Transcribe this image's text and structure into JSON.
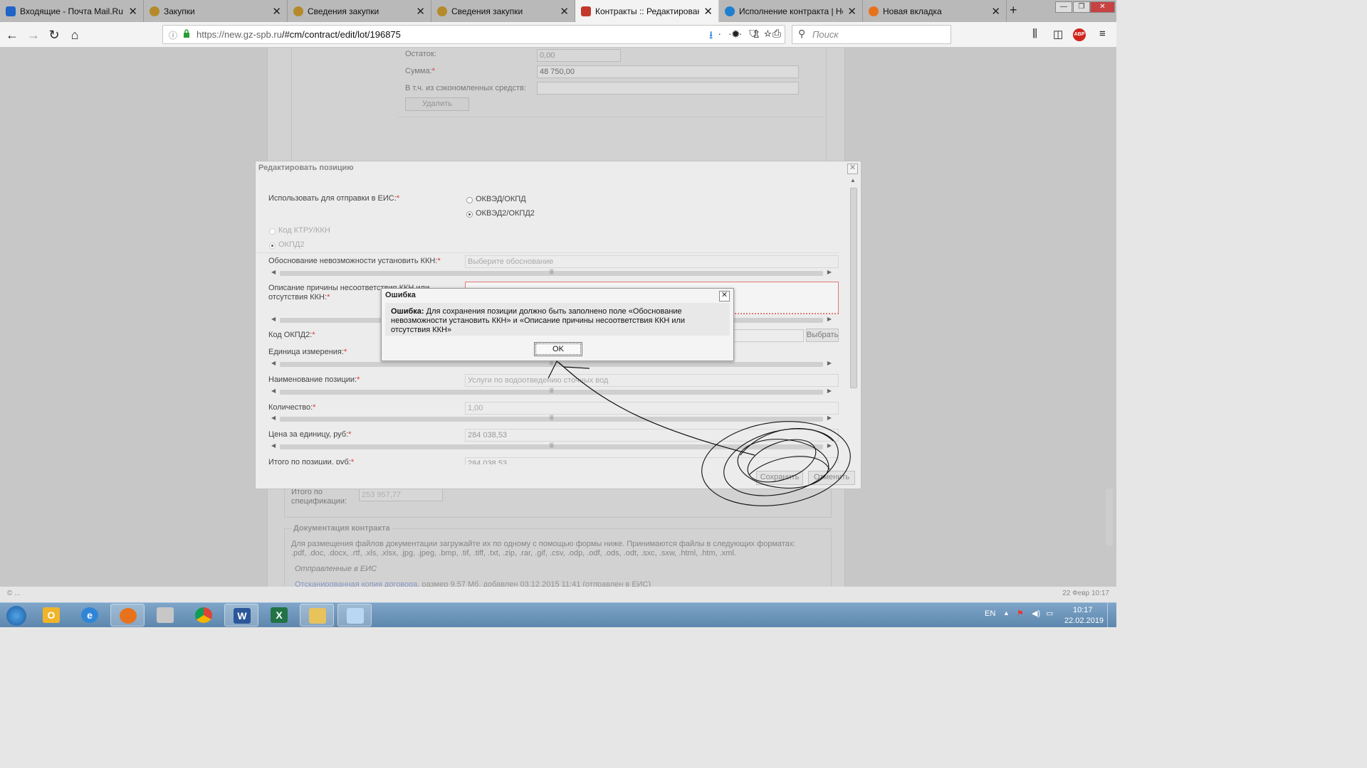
{
  "browser": {
    "tabs": [
      {
        "label": "Входящие - Почта Mail.Ru",
        "icon": "mail-icon",
        "color": "#1f64c6"
      },
      {
        "label": "Закупки",
        "icon": "emblem-icon",
        "color": "#b58a2a"
      },
      {
        "label": "Сведения закупки",
        "icon": "emblem-icon",
        "color": "#b58a2a"
      },
      {
        "label": "Сведения закупки",
        "icon": "emblem-icon",
        "color": "#b58a2a"
      },
      {
        "label": "Контракты :: Редактирование",
        "icon": "tools-icon",
        "color": "#c0392b"
      },
      {
        "label": "Исполнение контракта | Help",
        "icon": "help-icon",
        "color": "#1e7fd0"
      },
      {
        "label": "Новая вкладка",
        "icon": "firefox-icon",
        "color": "#e8721c"
      }
    ],
    "active_tab": 4,
    "url_host": "https://new.gz-spb.ru",
    "url_path": "/#cm/contract/edit/lot/196875",
    "search_placeholder": "Поиск",
    "adblock_badge": "ABP"
  },
  "background": {
    "ostatok_label": "Остаток:",
    "ostatok_value": "0,00",
    "summa_label": "Сумма:",
    "summa_value": "48 750,00",
    "saved_label": "В т.ч. из сэкономленных средств:",
    "delete_button": "Удалить",
    "spec_total_label": "Итого по спецификации:",
    "spec_total_value": "253 957,77",
    "docs_heading": "Документация контракта",
    "docs_hint": "Для размещения файлов документации загружайте их по одному с помощью формы ниже. Принимаются файлы в следующих форматах: .pdf, .doc, .docx, .rtf, .xls, .xlsx, .jpg, .jpeg, .bmp, .tif, .tiff, .txt, .zip, .rar, .gif, .csv, .odp, .odf, .ods, .odt, .sxc, .sxw, .html, .htm, .xml.",
    "sent_heading": "Отправленные в ЕИС",
    "file_link": "Отсканированная копия договора",
    "file_meta": ", размер 9,57 Мб, добавлен 03.12.2015 11:41 (отправлен в ЕИС)"
  },
  "edit_dialog": {
    "title": "Редактировать позицию",
    "send_label": "Использовать для отправки в ЕИС:",
    "opt_okved": "ОКВЭД/ОКПД",
    "opt_okved2": "ОКВЭД2/ОКПД2",
    "opt_ktru": "Код КТРУ/ККН",
    "opt_okpd2": "ОКПД2",
    "reason_label": "Обоснование невозможности установить ККН:",
    "reason_placeholder": "Выберите обоснование",
    "desc_label": "Описание причины несоответствия ККН или отсутствия ККН:",
    "okpd2_label": "Код ОКПД2:",
    "choose_button": "Выбрать",
    "unit_label": "Единица измерения:",
    "name_label": "Наименование позиции:",
    "name_value": "Услуги по водоотведению сточных вод",
    "qty_label": "Количество:",
    "qty_value": "1,00",
    "price_label": "Цена за единицу, руб:",
    "price_value": "284 038,53",
    "total_label": "Итого по позиции, руб:",
    "total_value": "284 038,53",
    "save_button": "Сохранить",
    "cancel_button": "Отменить"
  },
  "error_dialog": {
    "title": "Ошибка",
    "bold": "Ошибка:",
    "message": "Для сохранения позиции должно быть заполнено поле «Обоснование невозможности установить ККН» и «Описание причины несоответствия ККН или отсутствия ККН»",
    "ok_button": "OK"
  },
  "status_bar": {
    "left": "© ...",
    "right": "22 Февр 10:17"
  },
  "taskbar": {
    "lang": "EN",
    "time": "10:17",
    "date": "22.02.2019"
  }
}
